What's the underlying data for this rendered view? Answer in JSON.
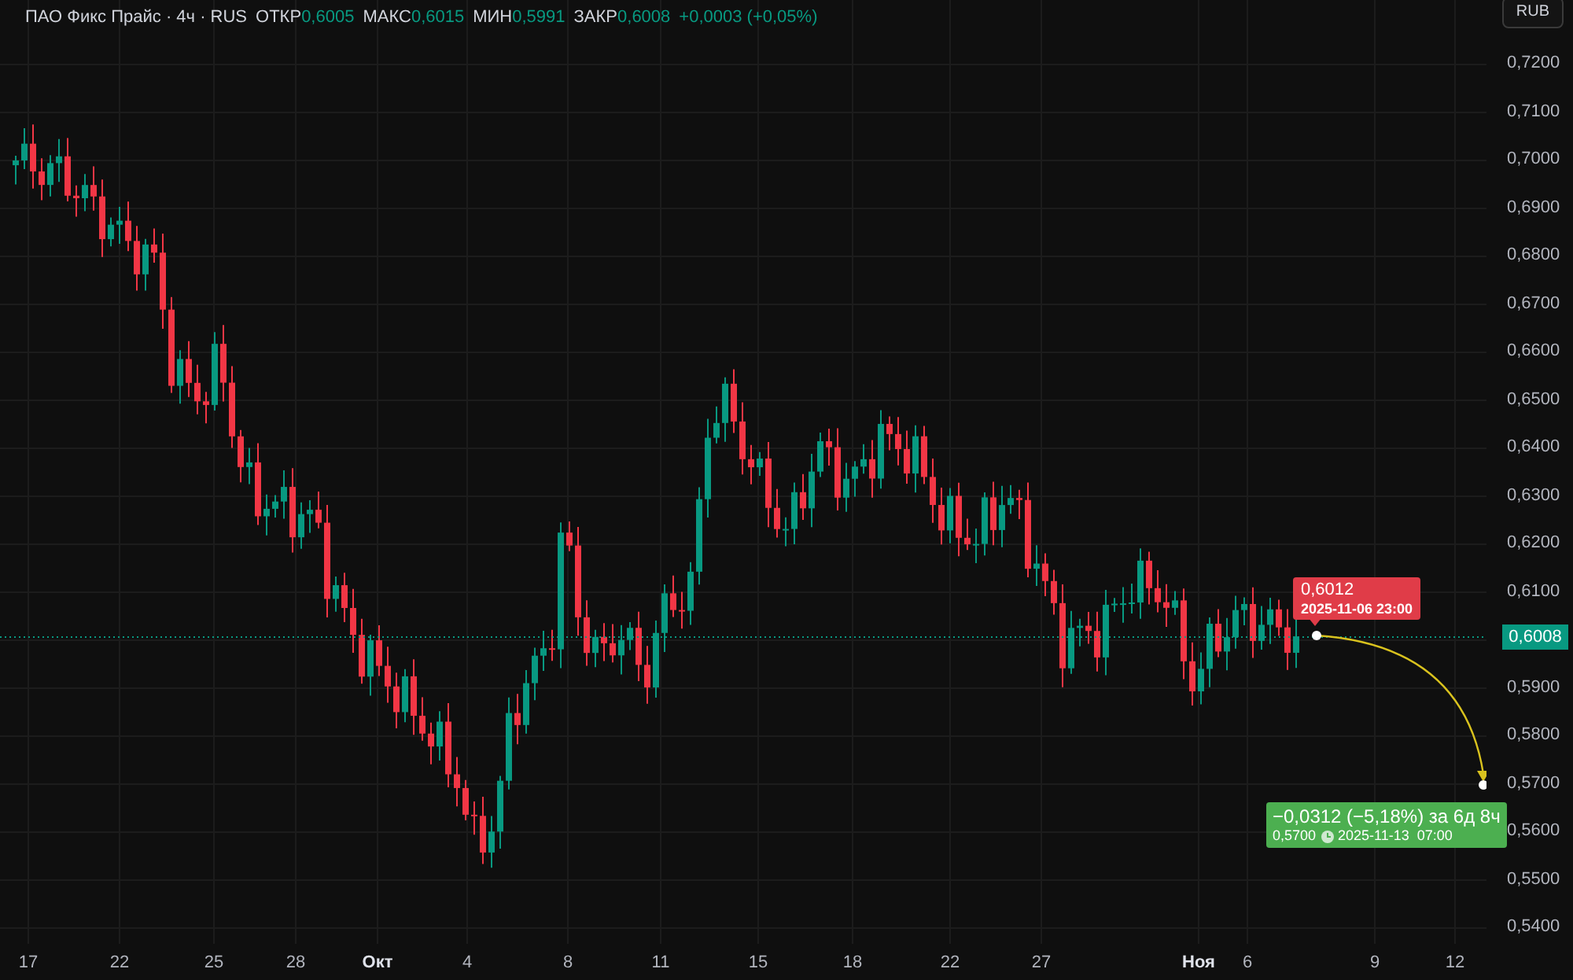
{
  "header": {
    "symbol": "ПАО Фикс Прайс · 4ч · RUS",
    "stats": [
      {
        "label": "ОТКР",
        "value": "0,6005"
      },
      {
        "label": "МАКС",
        "value": "0,6015"
      },
      {
        "label": "МИН",
        "value": "0,5991"
      },
      {
        "label": "ЗАКР",
        "value": "0,6008"
      }
    ],
    "change": "+0,0003 (+0,05%)"
  },
  "currency_button": "RUB",
  "y_axis": [
    "0,7200",
    "0,7100",
    "0,7000",
    "0,6900",
    "0,6800",
    "0,6700",
    "0,6600",
    "0,6500",
    "0,6400",
    "0,6300",
    "0,6200",
    "0,6100",
    "0,5900",
    "0,5800",
    "0,5700",
    "0,5600",
    "0,5500",
    "0,5400"
  ],
  "current_price": "0,6008",
  "x_axis": [
    {
      "label": "17",
      "kind": "day"
    },
    {
      "label": "22",
      "kind": "day"
    },
    {
      "label": "25",
      "kind": "day"
    },
    {
      "label": "28",
      "kind": "day"
    },
    {
      "label": "Окт",
      "kind": "month"
    },
    {
      "label": "4",
      "kind": "day"
    },
    {
      "label": "8",
      "kind": "day"
    },
    {
      "label": "11",
      "kind": "day"
    },
    {
      "label": "15",
      "kind": "day"
    },
    {
      "label": "18",
      "kind": "day"
    },
    {
      "label": "22",
      "kind": "day"
    },
    {
      "label": "27",
      "kind": "day"
    },
    {
      "label": "Ноя",
      "kind": "month"
    },
    {
      "label": "6",
      "kind": "day"
    },
    {
      "label": "9",
      "kind": "day"
    },
    {
      "label": "12",
      "kind": "day"
    }
  ],
  "start_callout": {
    "price": "0,6012",
    "time": "2025-11-06 23:00"
  },
  "projection": {
    "change": "−0,0312 (−5,18%) за 6д 8ч",
    "price": "0,5700",
    "time": "2025-11-13  07:00"
  }
}
